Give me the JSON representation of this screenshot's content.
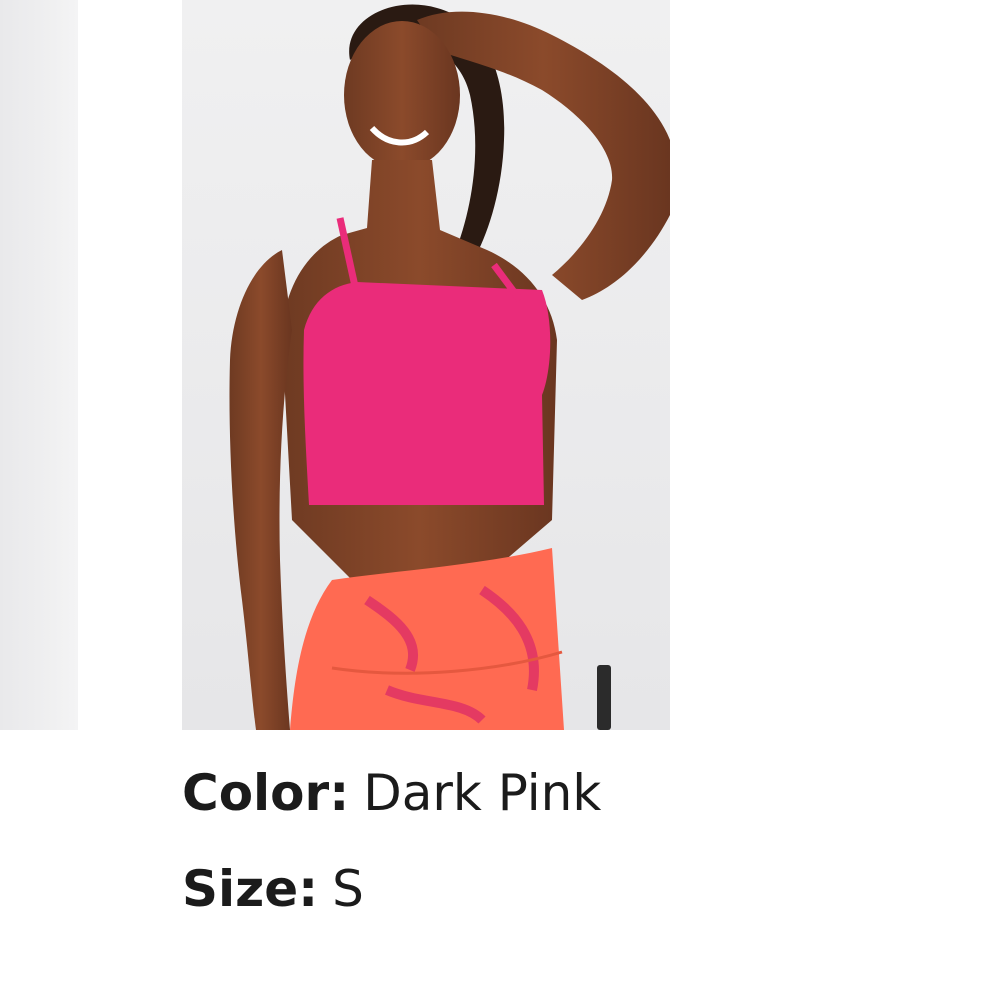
{
  "product": {
    "color": {
      "label": "Color:",
      "value": "Dark Pink"
    },
    "size": {
      "label": "Size:",
      "value": "S"
    }
  },
  "colors": {
    "top": "#ea2c7a",
    "bottoms": "#ff6a52",
    "background": "#eeeeef",
    "text": "#1b1b1b"
  }
}
